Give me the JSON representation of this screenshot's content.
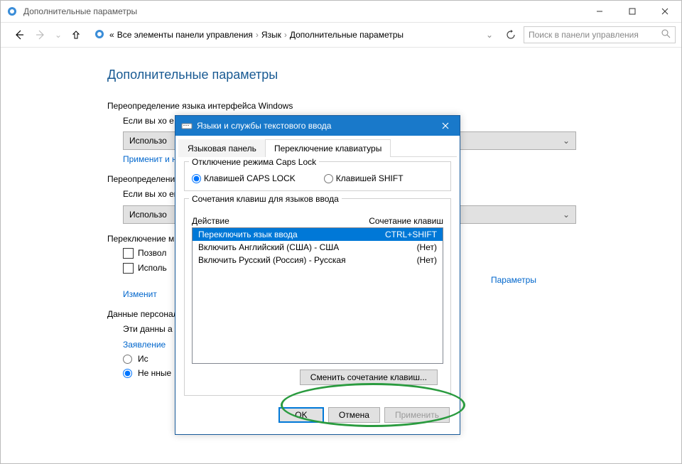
{
  "window": {
    "title": "Дополнительные параметры",
    "minimize": "—",
    "maximize": "▢",
    "close": "✕"
  },
  "nav": {
    "crumb_prefix": "«",
    "crumb1": "Все элементы панели управления",
    "crumb2": "Язык",
    "crumb3": "Дополнительные параметры",
    "search_placeholder": "Поиск в панели управления"
  },
  "page": {
    "heading": "Дополнительные параметры",
    "sec1_title": "Переопределение языка интерфейса Windows",
    "sec1_text": "Если вы хо                                                                                                     е вашем списке языков, выберите ег",
    "sec1_dropdown": "Использо",
    "sec1_link": "Применит                                                                                           и новым учетным записям пользоват",
    "sec2_title": "Переопределение",
    "sec2_text": "Если вы хо                                                                                                     ешем списке языков, выберите ег",
    "sec2_dropdown": "Использо",
    "sec3_title": "Переключение м",
    "sec3_cb1": "Позвол",
    "sec3_cb2": "Исполь",
    "sec3_link": "Изменит",
    "param_link": "Параметры",
    "sec4_title": "Данные персонал",
    "sec4_text1": "Эти данны                                                                                                   а и прогнозирование текста для языков                                                                                              орпорацию Майкрософт.",
    "sec4_link": "Заявление",
    "sec4_radio1": "Ис",
    "sec4_radio2": "Не                                                                                               нные"
  },
  "modal": {
    "title": "Языки и службы текстового ввода",
    "tab1": "Языковая панель",
    "tab2": "Переключение клавиатуры",
    "caps_group": "Отключение режима Caps Lock",
    "caps_opt1": "Клавишей CAPS LOCK",
    "caps_opt2": "Клавишей SHIFT",
    "hotkeys_group": "Сочетания клавиш для языков ввода",
    "col_action": "Действие",
    "col_hotkey": "Сочетание клавиш",
    "rows": [
      {
        "action": "Переключить язык ввода",
        "hotkey": "CTRL+SHIFT",
        "selected": true
      },
      {
        "action": "Включить Английский (США) - США",
        "hotkey": "(Нет)",
        "selected": false
      },
      {
        "action": "Включить Русский (Россия) - Русская",
        "hotkey": "(Нет)",
        "selected": false
      }
    ],
    "change_btn": "Сменить сочетание клавиш...",
    "ok": "OK",
    "cancel": "Отмена",
    "apply": "Применить"
  }
}
